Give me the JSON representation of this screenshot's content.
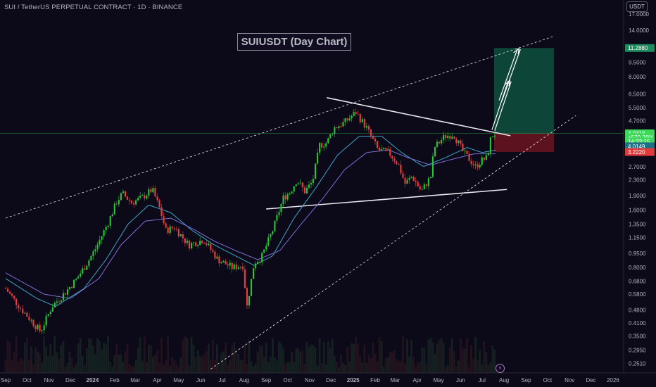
{
  "header": {
    "symbol": "SUI / TetherUS PERPETUAL CONTRACT · 1D · BINANCE",
    "currency": "USDT"
  },
  "icons": {
    "flash": "lightning-icon"
  },
  "colors": {
    "background": "#0c0919",
    "bull_candle": "#26c832",
    "bear_candle": "#ef3b3b",
    "ma_fast": "#3aa6c7",
    "ma_slow": "#7b6fd6",
    "target_zone": "#0e5140",
    "stop_zone": "#6b1421",
    "current_price": "#3bd85a"
  },
  "chart_data": {
    "type": "candlestick",
    "title": "SUIUSDT (Day Chart)",
    "xlabel": "",
    "ylabel": "",
    "y_scale": "log",
    "ylim": [
      0.24,
      18.5
    ],
    "x_range": [
      "2023-09-01",
      "2026-01-10"
    ],
    "x_tick_labels": [
      "Sep",
      "Oct",
      "Nov",
      "Dec",
      "2024",
      "Feb",
      "Mar",
      "Apr",
      "May",
      "Jun",
      "Jul",
      "Aug",
      "Sep",
      "Oct",
      "Nov",
      "Dec",
      "2025",
      "Feb",
      "Mar",
      "Apr",
      "May",
      "Jun",
      "Jul",
      "Aug",
      "Sep",
      "Oct",
      "Nov",
      "Dec",
      "2026"
    ],
    "x_tick_dates": [
      "2023-09-01",
      "2023-10-01",
      "2023-11-01",
      "2023-12-01",
      "2024-01-01",
      "2024-02-01",
      "2024-03-01",
      "2024-04-01",
      "2024-05-01",
      "2024-06-01",
      "2024-07-01",
      "2024-08-01",
      "2024-09-01",
      "2024-10-01",
      "2024-11-01",
      "2024-12-01",
      "2025-01-01",
      "2025-02-01",
      "2025-03-01",
      "2025-04-01",
      "2025-05-01",
      "2025-06-01",
      "2025-07-01",
      "2025-08-01",
      "2025-09-01",
      "2025-10-01",
      "2025-11-01",
      "2025-12-01",
      "2026-01-01"
    ],
    "y_tick_labels": [
      "17.0000",
      "14.0000",
      "9.5000",
      "8.0000",
      "6.5000",
      "5.5000",
      "4.7000",
      "2.7000",
      "2.3000",
      "1.9000",
      "1.6000",
      "1.3500",
      "1.1500",
      "0.9500",
      "0.8000",
      "0.6800",
      "0.5800",
      "0.4800",
      "0.4100",
      "0.3500",
      "0.2950",
      "0.2510"
    ],
    "y_tick_values": [
      17,
      14,
      9.5,
      8,
      6.5,
      5.5,
      4.7,
      2.7,
      2.3,
      1.9,
      1.6,
      1.35,
      1.15,
      0.95,
      0.8,
      0.68,
      0.58,
      0.48,
      0.41,
      0.35,
      0.295,
      0.251
    ],
    "price_path": [
      [
        "2023-09-01",
        0.62
      ],
      [
        "2023-09-20",
        0.5
      ],
      [
        "2023-10-12",
        0.4
      ],
      [
        "2023-10-20",
        0.37
      ],
      [
        "2023-11-05",
        0.5
      ],
      [
        "2023-11-25",
        0.6
      ],
      [
        "2023-12-10",
        0.7
      ],
      [
        "2023-12-25",
        0.85
      ],
      [
        "2024-01-05",
        1.0
      ],
      [
        "2024-01-22",
        1.35
      ],
      [
        "2024-02-05",
        1.8
      ],
      [
        "2024-02-12",
        1.95
      ],
      [
        "2024-02-25",
        1.75
      ],
      [
        "2024-03-10",
        1.85
      ],
      [
        "2024-03-25",
        2.05
      ],
      [
        "2024-04-05",
        1.6
      ],
      [
        "2024-04-13",
        1.25
      ],
      [
        "2024-04-25",
        1.3
      ],
      [
        "2024-05-15",
        1.05
      ],
      [
        "2024-06-05",
        1.12
      ],
      [
        "2024-06-25",
        0.88
      ],
      [
        "2024-07-15",
        0.8
      ],
      [
        "2024-07-30",
        0.82
      ],
      [
        "2024-08-05",
        0.5
      ],
      [
        "2024-08-15",
        0.85
      ],
      [
        "2024-08-25",
        0.9
      ],
      [
        "2024-09-10",
        1.25
      ],
      [
        "2024-09-25",
        1.85
      ],
      [
        "2024-10-05",
        2.0
      ],
      [
        "2024-10-14",
        2.3
      ],
      [
        "2024-10-25",
        2.0
      ],
      [
        "2024-11-05",
        2.25
      ],
      [
        "2024-11-15",
        3.5
      ],
      [
        "2024-11-25",
        3.6
      ],
      [
        "2024-12-05",
        4.3
      ],
      [
        "2024-12-20",
        4.6
      ],
      [
        "2025-01-05",
        5.2
      ],
      [
        "2025-01-20",
        4.3
      ],
      [
        "2025-02-05",
        3.3
      ],
      [
        "2025-02-20",
        3.2
      ],
      [
        "2025-03-05",
        2.8
      ],
      [
        "2025-03-15",
        2.2
      ],
      [
        "2025-03-25",
        2.4
      ],
      [
        "2025-04-07",
        2.0
      ],
      [
        "2025-04-20",
        2.4
      ],
      [
        "2025-04-25",
        3.4
      ],
      [
        "2025-05-10",
        3.9
      ],
      [
        "2025-05-22",
        4.0
      ],
      [
        "2025-06-05",
        3.2
      ],
      [
        "2025-06-22",
        2.7
      ],
      [
        "2025-06-30",
        2.9
      ],
      [
        "2025-07-08",
        3.0
      ],
      [
        "2025-07-14",
        3.9
      ],
      [
        "2025-07-20",
        4.03
      ]
    ],
    "ma_fast_path": [
      [
        "2023-09-01",
        0.7
      ],
      [
        "2023-10-15",
        0.55
      ],
      [
        "2023-11-10",
        0.5
      ],
      [
        "2023-12-20",
        0.62
      ],
      [
        "2024-01-20",
        0.88
      ],
      [
        "2024-02-20",
        1.35
      ],
      [
        "2024-03-20",
        1.7
      ],
      [
        "2024-04-20",
        1.55
      ],
      [
        "2024-05-20",
        1.25
      ],
      [
        "2024-06-20",
        1.05
      ],
      [
        "2024-07-20",
        0.92
      ],
      [
        "2024-08-15",
        0.82
      ],
      [
        "2024-09-10",
        0.92
      ],
      [
        "2024-10-10",
        1.45
      ],
      [
        "2024-11-10",
        2.1
      ],
      [
        "2024-12-10",
        3.1
      ],
      [
        "2025-01-10",
        3.9
      ],
      [
        "2025-02-10",
        3.9
      ],
      [
        "2025-03-10",
        3.2
      ],
      [
        "2025-04-10",
        2.7
      ],
      [
        "2025-05-10",
        3.0
      ],
      [
        "2025-06-10",
        3.4
      ],
      [
        "2025-07-01",
        3.2
      ],
      [
        "2025-07-20",
        3.3
      ]
    ],
    "ma_slow_path": [
      [
        "2023-09-01",
        0.75
      ],
      [
        "2023-10-25",
        0.58
      ],
      [
        "2023-12-01",
        0.55
      ],
      [
        "2024-01-10",
        0.7
      ],
      [
        "2024-02-10",
        1.05
      ],
      [
        "2024-03-15",
        1.4
      ],
      [
        "2024-04-20",
        1.45
      ],
      [
        "2024-05-20",
        1.28
      ],
      [
        "2024-06-20",
        1.1
      ],
      [
        "2024-07-20",
        0.98
      ],
      [
        "2024-08-20",
        0.88
      ],
      [
        "2024-09-20",
        0.98
      ],
      [
        "2024-10-20",
        1.35
      ],
      [
        "2024-11-20",
        1.85
      ],
      [
        "2024-12-20",
        2.6
      ],
      [
        "2025-01-20",
        3.2
      ],
      [
        "2025-02-20",
        3.3
      ],
      [
        "2025-03-20",
        3.0
      ],
      [
        "2025-04-20",
        2.75
      ],
      [
        "2025-05-20",
        2.95
      ],
      [
        "2025-06-20",
        3.15
      ],
      [
        "2025-07-20",
        3.15
      ]
    ],
    "annotations": {
      "channel_upper": {
        "start": [
          "2023-09-01",
          1.45
        ],
        "end": [
          "2025-10-10",
          13.0
        ]
      },
      "channel_lower": {
        "start": [
          "2024-06-15",
          0.235
        ],
        "end": [
          "2025-11-10",
          5.0
        ]
      },
      "triangle_resistance": {
        "start": [
          "2024-11-25",
          6.2
        ],
        "end": [
          "2025-08-10",
          3.92
        ]
      },
      "triangle_support": {
        "start": [
          "2024-09-01",
          1.62
        ],
        "end": [
          "2025-08-05",
          2.05
        ]
      },
      "arrow_1": {
        "start": [
          "2025-07-15",
          4.2
        ],
        "end": [
          "2025-08-07",
          7.6
        ]
      },
      "arrow_2": {
        "start": [
          "2025-07-25",
          6.0
        ],
        "end": [
          "2025-08-20",
          11.2
        ]
      },
      "target_zone": {
        "x0": "2025-07-18",
        "x1": "2025-10-10",
        "y0": 4.03,
        "y1": 11.29
      },
      "stop_zone": {
        "x0": "2025-07-18",
        "x1": "2025-10-10",
        "y0": 3.22,
        "y1": 4.03
      }
    },
    "price_tags": [
      {
        "label": "11.2880",
        "value": 11.288,
        "color": "#1f8a5e"
      },
      {
        "label": "4.0318",
        "value": 4.0318,
        "color": "#3bd85a"
      },
      {
        "label": "+570.26%",
        "value": 3.85,
        "color": "#3bd85a"
      },
      {
        "label": "14:33:25",
        "value": 3.66,
        "color": "#3bd85a"
      },
      {
        "label": "4.0149",
        "value": 3.45,
        "color": "#1f6f84"
      },
      {
        "label": "3.2220",
        "value": 3.222,
        "color": "#e03a3a"
      }
    ]
  }
}
